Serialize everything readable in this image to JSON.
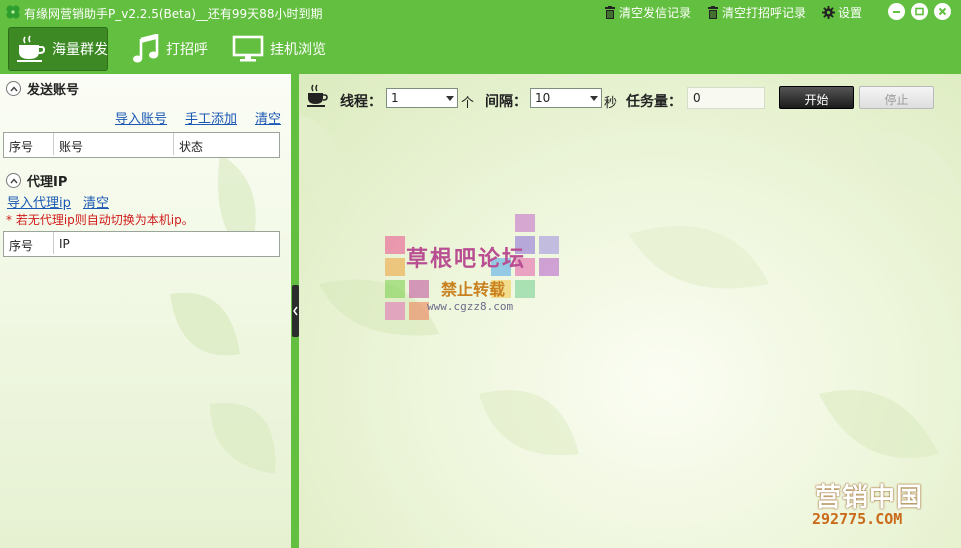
{
  "app": {
    "title": "有缘网营销助手P_v2.2.5(Beta)__还有99天88小时到期"
  },
  "titlebar": {
    "clear_send_label": "清空发信记录",
    "clear_greet_label": "清空打招呼记录",
    "settings_label": "设置"
  },
  "toolbar": {
    "items": [
      {
        "label": "海量群发",
        "icon": "coffee-cup-icon"
      },
      {
        "label": "打招呼",
        "icon": "music-note-icon"
      },
      {
        "label": "挂机浏览",
        "icon": "monitor-icon"
      }
    ]
  },
  "accounts": {
    "heading": "发送账号",
    "import_label": "导入账号",
    "manual_add_label": "手工添加",
    "clear_label": "清空",
    "columns": [
      "序号",
      "账号",
      "状态"
    ]
  },
  "proxy": {
    "heading": "代理IP",
    "import_label": "导入代理ip",
    "clear_label": "清空",
    "note": "* 若无代理ip则自动切换为本机ip。",
    "columns": [
      "序号",
      "IP"
    ]
  },
  "controls": {
    "threads_label": "线程：",
    "threads_value": "1",
    "threads_unit": "个",
    "interval_label": "间隔：",
    "interval_value": "10",
    "interval_unit": "秒",
    "task_label": "任务量：",
    "task_value": "0",
    "start_label": "开始",
    "stop_label": "停止"
  },
  "watermark": {
    "title": "草根吧论坛",
    "subtitle": "禁止转载",
    "url": "www.cgzz8.com"
  },
  "corner_mark": {
    "title": "营销中国",
    "subtitle": "292775.COM"
  },
  "colors": {
    "frame_green": "#63bf3f",
    "active_tab": "#3d8a25",
    "link_blue": "#1b58b4",
    "note_red": "#d01b1b"
  }
}
